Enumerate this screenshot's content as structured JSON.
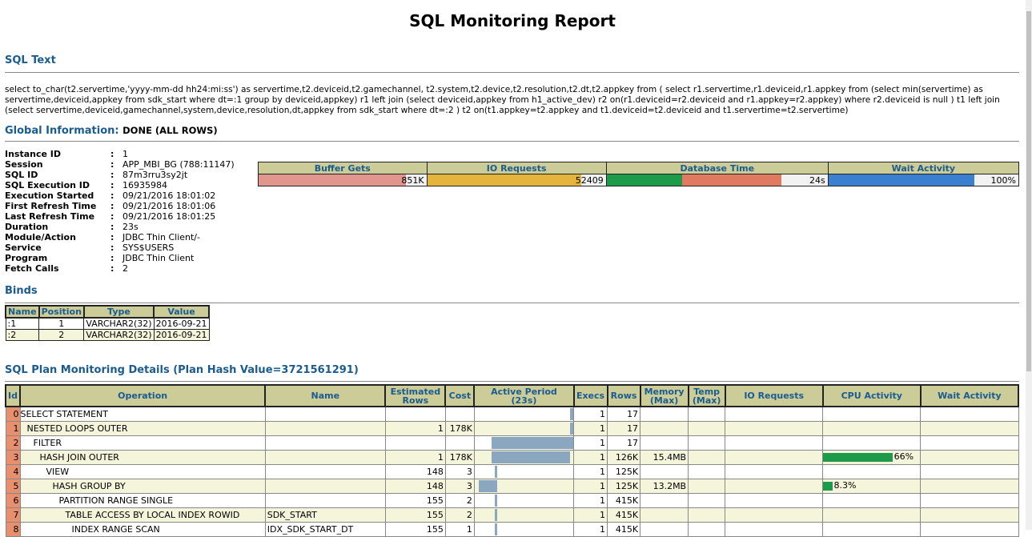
{
  "report_title": "SQL Monitoring Report",
  "sql_text_heading": "SQL Text",
  "sql_text": "select to_char(t2.servertime,'yyyy-mm-dd hh24:mi:ss') as servertime,t2.deviceid,t2.gamechannel, t2.system,t2.device,t2.resolution,t2.dt,t2.appkey from ( select r1.servertime,r1.deviceid,r1.appkey from (select min(servertime) as servertime,deviceid,appkey from sdk_start where dt=:1 group by deviceid,appkey) r1 left join (select deviceid,appkey from h1_active_dev) r2 on(r1.deviceid=r2.deviceid and r1.appkey=r2.appkey) where r2.deviceid is null ) t1 left join (select servertime,deviceid,gamechannel,system,device,resolution,dt,appkey from sdk_start where dt=:2 ) t2 on(t1.appkey=t2.appkey and t1.deviceid=t2.deviceid and t1.servertime=t2.servertime)",
  "global_info_heading": "Global Information:",
  "global_status": "DONE (ALL ROWS)",
  "global_info": [
    {
      "key": "Instance ID",
      "value": "1"
    },
    {
      "key": "Session",
      "value": "APP_MBI_BG (788:11147)"
    },
    {
      "key": "SQL ID",
      "value": "87m3rru3sy2jt"
    },
    {
      "key": "SQL Execution ID",
      "value": "16935984"
    },
    {
      "key": "Execution Started",
      "value": "09/21/2016 18:01:02"
    },
    {
      "key": "First Refresh Time",
      "value": "09/21/2016 18:01:06"
    },
    {
      "key": "Last Refresh Time",
      "value": "09/21/2016 18:01:25"
    },
    {
      "key": "Duration",
      "value": "23s"
    },
    {
      "key": "Module/Action",
      "value": "JDBC Thin Client/-"
    },
    {
      "key": "Service",
      "value": "SYS$USERS"
    },
    {
      "key": "Program",
      "value": "JDBC Thin Client"
    },
    {
      "key": "Fetch Calls",
      "value": "2"
    }
  ],
  "metrics": [
    {
      "label": "Buffer Gets",
      "value": "851K",
      "fill": 0.88,
      "color": "#e0968c"
    },
    {
      "label": "IO Requests",
      "value": "52409",
      "fill": 0.86,
      "color": "#e4b43c"
    },
    {
      "label": "Database Time",
      "value": "24s",
      "fill": 0.79,
      "color": "#e07a60",
      "fill2": 0.34,
      "color2": "#1d9a4a"
    },
    {
      "label": "Wait Activity",
      "value": "100%",
      "fill": 0.77,
      "color": "#3a7fd0"
    }
  ],
  "binds_heading": "Binds",
  "binds_headers": [
    "Name",
    "Position",
    "Type",
    "Value"
  ],
  "binds": [
    {
      "name": ":1",
      "position": "1",
      "type": "VARCHAR2(32)",
      "value": "2016-09-21"
    },
    {
      "name": ":2",
      "position": "2",
      "type": "VARCHAR2(32)",
      "value": "2016-09-21"
    }
  ],
  "plan_heading": "SQL Plan Monitoring Details (Plan Hash Value=3721561291)",
  "plan_headers": {
    "id": "Id",
    "operation": "Operation",
    "name": "Name",
    "est_rows_1": "Estimated",
    "est_rows_2": "Rows",
    "cost": "Cost",
    "active_1": "Active Period",
    "active_2": "(23s)",
    "execs": "Execs",
    "rows": "Rows",
    "memory_1": "Memory",
    "memory_2": "(Max)",
    "temp_1": "Temp",
    "temp_2": "(Max)",
    "io": "IO Requests",
    "cpu": "CPU Activity",
    "wait": "Wait Activity"
  },
  "plan_rows": [
    {
      "id": "0",
      "operation": "SELECT STATEMENT",
      "name": "",
      "est_rows": "",
      "cost": "",
      "active_start": 0.97,
      "active_end": 1.0,
      "execs": "1",
      "rows": "17",
      "memory": "",
      "temp": "",
      "io": "",
      "cpu": "",
      "cpu_fill": 0,
      "wait": ""
    },
    {
      "id": "1",
      "operation": "NESTED LOOPS OUTER",
      "name": "",
      "est_rows": "1",
      "cost": "178K",
      "active_start": 0.97,
      "active_end": 1.0,
      "execs": "1",
      "rows": "17",
      "memory": "",
      "temp": "",
      "io": "",
      "cpu": "",
      "cpu_fill": 0,
      "wait": ""
    },
    {
      "id": "2",
      "operation": "FILTER",
      "name": "",
      "est_rows": "",
      "cost": "",
      "active_start": 0.17,
      "active_end": 1.0,
      "execs": "1",
      "rows": "17",
      "memory": "",
      "temp": "",
      "io": "",
      "cpu": "",
      "cpu_fill": 0,
      "wait": ""
    },
    {
      "id": "3",
      "operation": "HASH JOIN OUTER",
      "name": "",
      "est_rows": "1",
      "cost": "178K",
      "active_start": 0.17,
      "active_end": 0.97,
      "execs": "1",
      "rows": "126K",
      "memory": "15.4MB",
      "temp": "",
      "io": "",
      "cpu": "66%",
      "cpu_fill": 0.72,
      "wait": ""
    },
    {
      "id": "4",
      "operation": "VIEW",
      "name": "",
      "est_rows": "148",
      "cost": "3",
      "active_start": 0.2,
      "active_end": 0.23,
      "execs": "1",
      "rows": "125K",
      "memory": "",
      "temp": "",
      "io": "",
      "cpu": "",
      "cpu_fill": 0,
      "wait": ""
    },
    {
      "id": "5",
      "operation": "HASH GROUP BY",
      "name": "",
      "est_rows": "148",
      "cost": "3",
      "active_start": 0.04,
      "active_end": 0.23,
      "execs": "1",
      "rows": "125K",
      "memory": "13.2MB",
      "temp": "",
      "io": "",
      "cpu": "8.3%",
      "cpu_fill": 0.1,
      "wait": ""
    },
    {
      "id": "6",
      "operation": "PARTITION RANGE SINGLE",
      "name": "",
      "est_rows": "155",
      "cost": "2",
      "active_start": 0.2,
      "active_end": 0.23,
      "execs": "1",
      "rows": "415K",
      "memory": "",
      "temp": "",
      "io": "",
      "cpu": "",
      "cpu_fill": 0,
      "wait": ""
    },
    {
      "id": "7",
      "operation": "TABLE ACCESS BY LOCAL INDEX ROWID",
      "name": "SDK_START",
      "est_rows": "155",
      "cost": "2",
      "active_start": 0.2,
      "active_end": 0.23,
      "execs": "1",
      "rows": "415K",
      "memory": "",
      "temp": "",
      "io": "",
      "cpu": "",
      "cpu_fill": 0,
      "wait": ""
    },
    {
      "id": "8",
      "operation": "INDEX RANGE SCAN",
      "name": "IDX_SDK_START_DT",
      "est_rows": "155",
      "cost": "1",
      "active_start": 0.2,
      "active_end": 0.23,
      "execs": "1",
      "rows": "415K",
      "memory": "",
      "temp": "",
      "io": "",
      "cpu": "",
      "cpu_fill": 0,
      "wait": ""
    }
  ]
}
